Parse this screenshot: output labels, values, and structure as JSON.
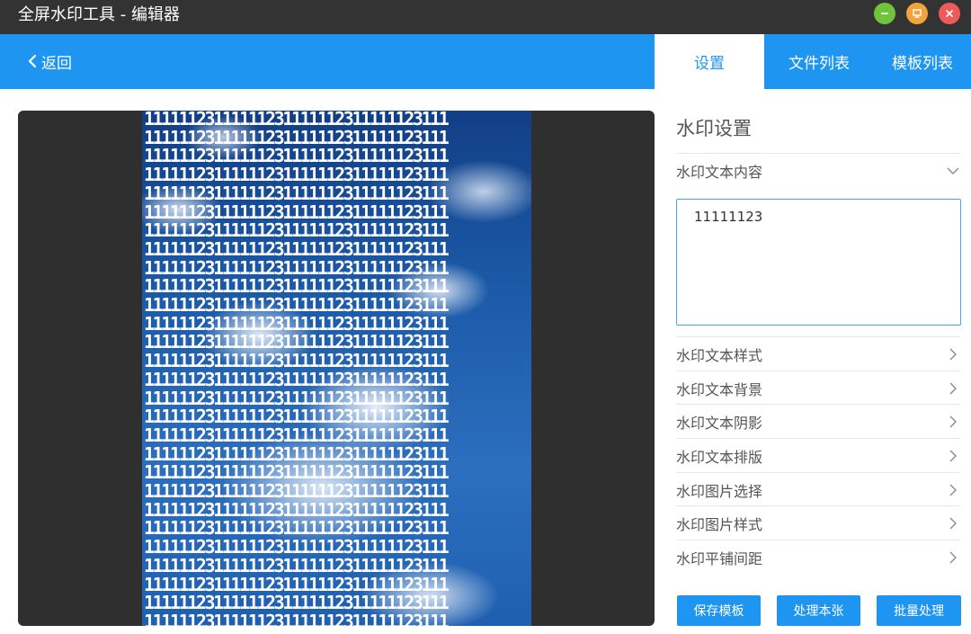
{
  "app": {
    "title": "全屏水印工具 - 编辑器",
    "colors": {
      "accent": "#1e95f0",
      "titlebar": "#333333",
      "minimize": "#6fc43b",
      "maximize": "#f0a43a",
      "close": "#ee5a5a"
    }
  },
  "window_controls": {
    "minimize_icon": "minus-icon",
    "maximize_icon": "monitor-icon",
    "close_icon": "close-icon"
  },
  "navbar": {
    "back_label": "返回",
    "tabs": [
      {
        "label": "设置",
        "active": true
      },
      {
        "label": "文件列表",
        "active": false
      },
      {
        "label": "模板列表",
        "active": false
      }
    ]
  },
  "preview": {
    "watermark_rows": [
      "11111123111111231111112311111123111",
      "11111123111111231111112311111123111",
      "11111123111111231111112311111123111",
      "11111123111111231111112311111123111",
      "11111123111111231111112311111123111",
      "11111123111111231111112311111123111",
      "11111123111111231111112311111123111",
      "11111123111111231111112311111123111",
      "11111123111111231111112311111123111",
      "11111123111111231111112311111123111",
      "11111123111111231111112311111123111",
      "11111123111111231111112311111123111",
      "11111123111111231111112311111123111",
      "11111123111111231111112311111123111",
      "11111123111111231111112311111123111",
      "11111123111111231111112311111123111",
      "11111123111111231111112311111123111",
      "11111123111111231111112311111123111",
      "11111123111111231111112311111123111",
      "11111123111111231111112311111123111",
      "11111123111111231111112311111123111",
      "11111123111111231111112311111123111",
      "11111123111111231111112311111123111",
      "11111123111111231111112311111123111",
      "11111123111111231111112311111123111",
      "11111123111111231111112311111123111",
      "11111123111111231111112311111123111",
      "11111123111111231111112311111123111"
    ]
  },
  "settings": {
    "title": "水印设置",
    "text_content": {
      "label": "水印文本内容",
      "value": "11111123",
      "icon": "chevron-down-icon"
    },
    "sections": [
      {
        "label": "水印文本样式",
        "icon": "chevron-right-icon"
      },
      {
        "label": "水印文本背景",
        "icon": "chevron-right-icon"
      },
      {
        "label": "水印文本阴影",
        "icon": "chevron-right-icon"
      },
      {
        "label": "水印文本排版",
        "icon": "chevron-right-icon"
      },
      {
        "label": "水印图片选择",
        "icon": "chevron-right-icon"
      },
      {
        "label": "水印图片样式",
        "icon": "chevron-right-icon"
      },
      {
        "label": "水印平铺间距",
        "icon": "chevron-right-icon"
      }
    ],
    "buttons": {
      "save_template": "保存模板",
      "process_this": "处理本张",
      "batch_process": "批量处理"
    }
  }
}
